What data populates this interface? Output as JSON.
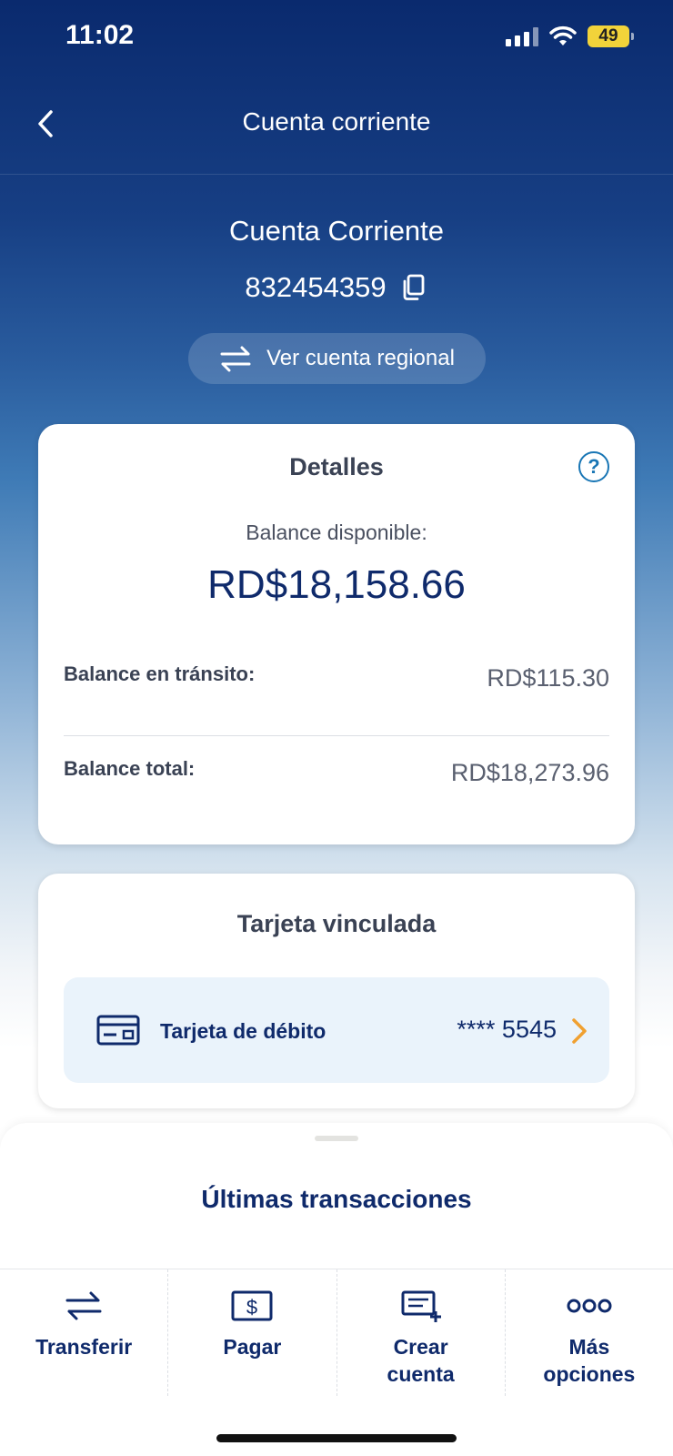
{
  "status_bar": {
    "time": "11:02",
    "battery": "49"
  },
  "nav": {
    "title": "Cuenta corriente"
  },
  "account": {
    "name": "Cuenta Corriente",
    "number": "832454359",
    "regional_button": "Ver cuenta regional"
  },
  "details": {
    "title": "Detalles",
    "help": "?",
    "available_label": "Balance disponible:",
    "available_value": "RD$18,158.66",
    "transit_label": "Balance en tránsito:",
    "transit_value": "RD$115.30",
    "total_label": "Balance total:",
    "total_value": "RD$18,273.96"
  },
  "linked": {
    "title": "Tarjeta vinculada",
    "card_label": "Tarjeta de débito",
    "card_number": "**** 5545"
  },
  "sheet": {
    "title": "Últimas transacciones"
  },
  "tabs": [
    {
      "label": "Transferir",
      "icon": "transfer-icon"
    },
    {
      "label": "Pagar",
      "icon": "pay-icon"
    },
    {
      "label": "Crear\ncuenta",
      "icon": "create-account-icon"
    },
    {
      "label": "Más\nopciones",
      "icon": "more-icon"
    }
  ],
  "colors": {
    "primary": "#0f2a6b",
    "accent": "#1976b5",
    "chevron": "#f0a030",
    "battery": "#f2d33a"
  }
}
